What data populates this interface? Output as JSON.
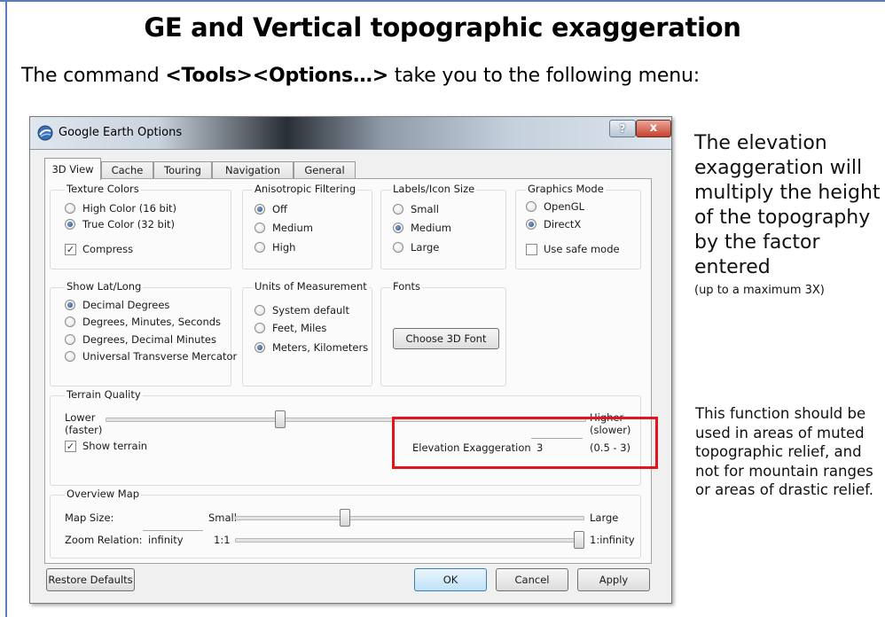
{
  "slide": {
    "title": "GE and Vertical topographic exaggeration",
    "intro_prefix": "The command ",
    "intro_command": "<Tools><Options…>",
    "intro_suffix": " take you to the following menu:"
  },
  "dialog": {
    "title": "Google Earth Options",
    "help_label": "?",
    "close_label": "x",
    "tabs": [
      {
        "label": "3D View",
        "active": true
      },
      {
        "label": "Cache"
      },
      {
        "label": "Touring"
      },
      {
        "label": "Navigation"
      },
      {
        "label": "General"
      }
    ],
    "texture_colors": {
      "label": "Texture Colors",
      "options": [
        "High Color (16 bit)",
        "True Color (32 bit)"
      ],
      "selected": "True Color (32 bit)",
      "compress_label": "Compress",
      "compress_checked": true
    },
    "anisotropic": {
      "label": "Anisotropic Filtering",
      "options": [
        "Off",
        "Medium",
        "High"
      ],
      "selected": "Off"
    },
    "labels_icon_size": {
      "label": "Labels/Icon Size",
      "options": [
        "Small",
        "Medium",
        "Large"
      ],
      "selected": "Medium"
    },
    "graphics_mode": {
      "label": "Graphics Mode",
      "options": [
        "OpenGL",
        "DirectX"
      ],
      "selected": "DirectX",
      "safe_mode_label": "Use safe mode",
      "safe_mode_checked": false
    },
    "show_lat_long": {
      "label": "Show Lat/Long",
      "options": [
        "Decimal Degrees",
        "Degrees, Minutes, Seconds",
        "Degrees, Decimal Minutes",
        "Universal Transverse Mercator"
      ],
      "selected": "Decimal Degrees"
    },
    "units": {
      "label": "Units of Measurement",
      "options": [
        "System default",
        "Feet, Miles",
        "Meters, Kilometers"
      ],
      "selected": "Meters, Kilometers"
    },
    "fonts": {
      "label": "Fonts",
      "button": "Choose 3D Font"
    },
    "terrain": {
      "label": "Terrain Quality",
      "lower": "Lower",
      "faster": "(faster)",
      "higher": "Higher",
      "slower": "(slower)",
      "slider_level": 0.36,
      "show_terrain_label": "Show terrain",
      "show_terrain_checked": true,
      "elevation_label": "Elevation Exaggeration:",
      "elevation_value": "3",
      "elevation_range": "(0.5 - 3)"
    },
    "overview_map": {
      "label": "Overview Map",
      "map_size_label": "Map Size:",
      "small": "Small",
      "large": "Large",
      "map_size_level": 0.31,
      "zoom_label": "Zoom Relation:",
      "zoom_value": "infinity",
      "zoom_min": "1:1",
      "zoom_max": "1:infinity",
      "zoom_level": 1.0
    },
    "buttons": {
      "restore": "Restore Defaults",
      "ok": "OK",
      "cancel": "Cancel",
      "apply": "Apply"
    }
  },
  "notes": {
    "main": "The elevation exaggeration will multiply the height of the topography by the factor entered",
    "main_small": "(up to a maximum 3X)",
    "secondary": "This function should be used in areas of muted topographic relief, and not for mountain ranges or areas of drastic relief."
  },
  "colors": {
    "highlight": "#e3141f",
    "slide_accent": "#5b7fb5"
  }
}
